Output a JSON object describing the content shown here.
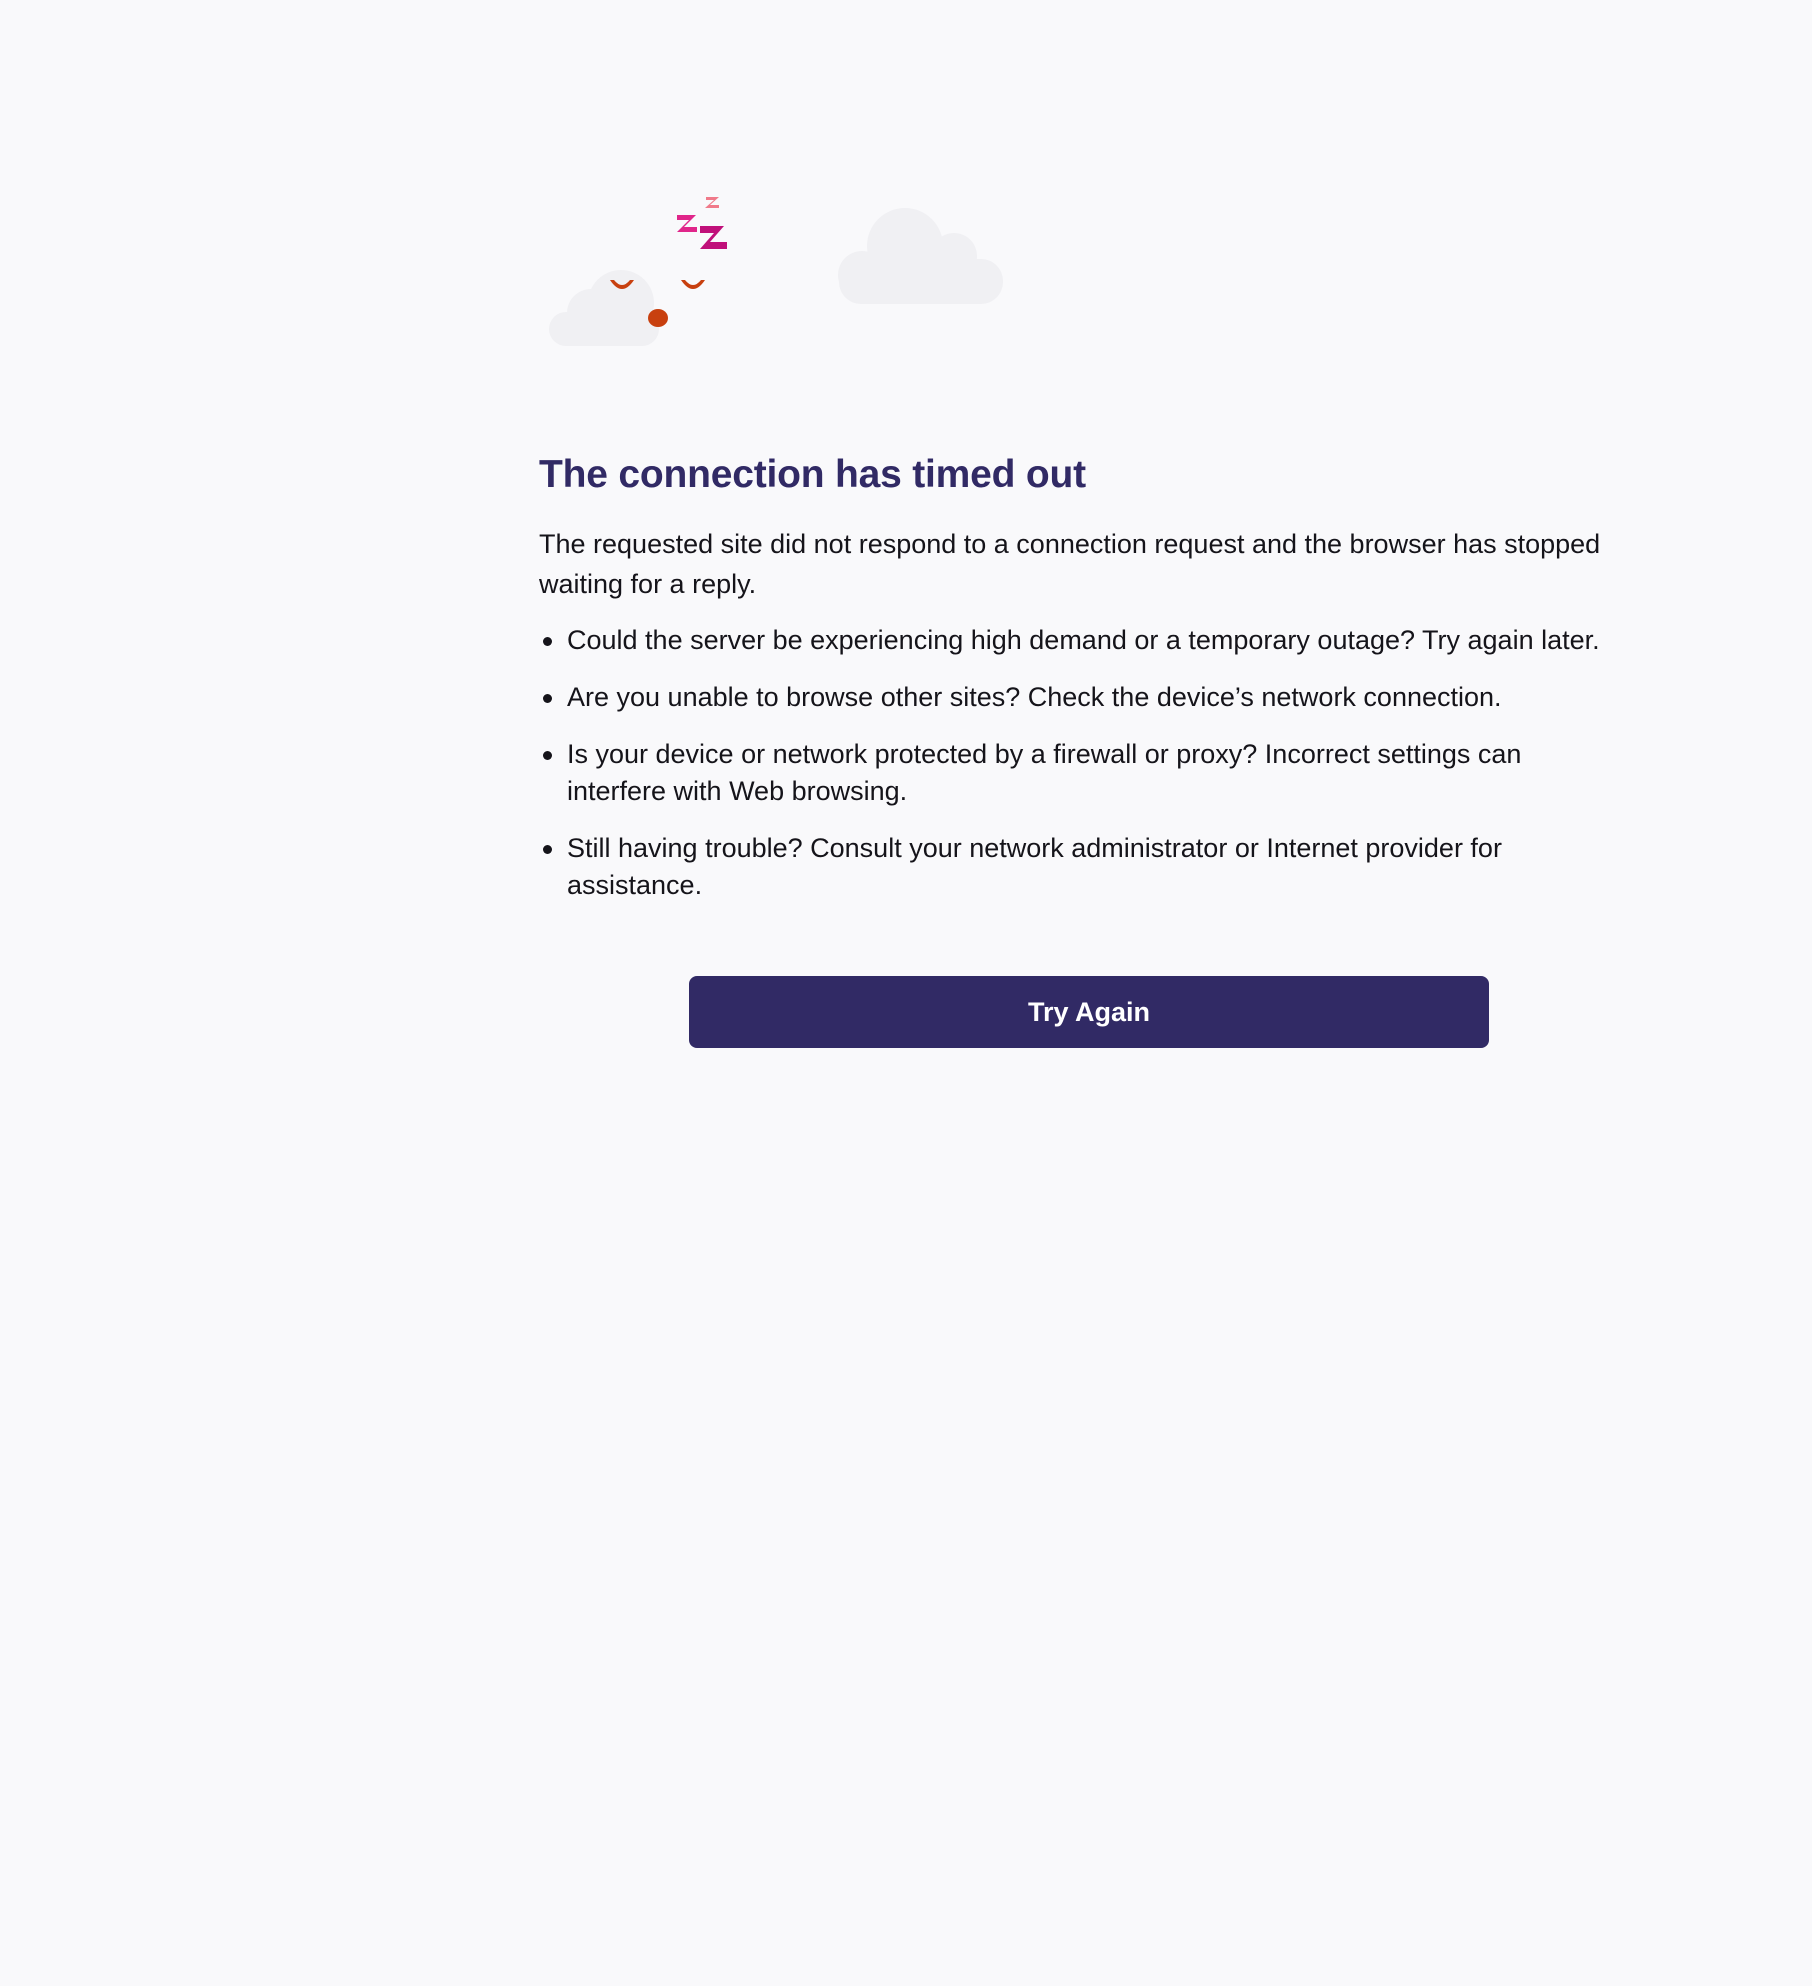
{
  "error": {
    "title": "The connection has timed out",
    "description": "The requested site did not respond to a connection request and the browser has stopped waiting for a reply.",
    "tips": [
      "Could the server be experiencing high demand or a temporary outage? Try again later.",
      "Are you unable to browse other sites? Check the device’s network connection.",
      "Is your device or network protected by a firewall or proxy? Incorrect settings can interfere with Web browsing.",
      "Still having trouble? Consult your network administrator or Internet provider for assistance."
    ],
    "try_again_label": "Try Again"
  },
  "illustration": {
    "icons": [
      "sleeping-face-icon",
      "zzz-icon",
      "cloud-icon"
    ],
    "colors": {
      "face": "#c8400f",
      "zzz_large": "#c0107a",
      "zzz_medium": "#e0268a",
      "zzz_small": "#f07a8a",
      "cloud": "#f0f0f3",
      "title": "#312a65",
      "button": "#312a65",
      "background": "#f9f9fb"
    }
  }
}
